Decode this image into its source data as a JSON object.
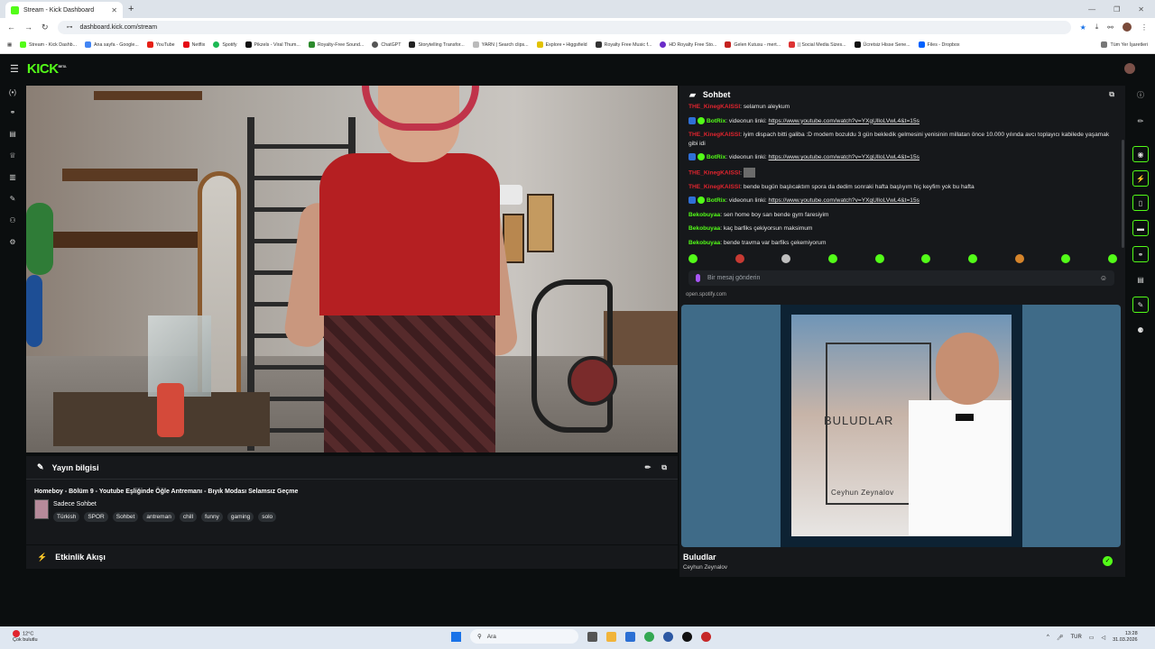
{
  "browser": {
    "tab_title": "Stream - Kick Dashboard",
    "url": "dashboard.kick.com/stream",
    "bookmarks": [
      "Stream - Kick Dashb...",
      "Ana sayfa - Google...",
      "YouTube",
      "Netflix",
      "Spotify",
      "Pikzels - Viral Thum...",
      "Royalty-Free Sound...",
      "ChatGPT",
      "Storytelling Transfor...",
      "YARN | Search clips...",
      "Explore • Higgsfield",
      "Royalty Free Music f...",
      "HD Royalty Free Sto...",
      "Gelen Kutusu - mert...",
      "|| Social Media Sizes...",
      "Ücretsiz Hisse Sene...",
      "Files - Dropbox"
    ],
    "all_bookmarks": "Tüm Yer İşaretleri"
  },
  "app": {
    "logo": "KICK",
    "logo_tag": "BETA"
  },
  "stream_info": {
    "header": "Yayın bilgisi",
    "title": "Homeboy - Bölüm 9 - Youtube Eşliğinde Öğle Antremanı - Bıyık Modası Selamsız Geçme",
    "category": "Sadece Sohbet",
    "tags": [
      "Türkish",
      "SPOR",
      "Sohbet",
      "antreman",
      "chill",
      "funny",
      "gaming",
      "solo"
    ]
  },
  "activity": {
    "header": "Etkinlik Akışı"
  },
  "chat": {
    "header": "Sohbet",
    "messages": [
      {
        "user": "THE_KinegKAISSI",
        "text": ": selamun aleykum",
        "kind": "red"
      },
      {
        "user": "BotRix",
        "text": ": videonun linki: ",
        "link": "https://www.youtube.com/watch?v=YXgUlloLVwL4&t=15s",
        "kind": "bot"
      },
      {
        "user": "THE_KinegKAISSI",
        "text": ": iyim dispach bitti galiba :D modem bozuldu 3 gün bekledik gelmesini yenisinin millatan önce 10.000 yılında avcı toplayıcı kabilede yaşamak gibi idi",
        "kind": "red"
      },
      {
        "user": "BotRix",
        "text": ": videonun linki: ",
        "link": "https://www.youtube.com/watch?v=YXgUlloLVwL4&t=15s",
        "kind": "bot"
      },
      {
        "user": "THE_KinegKAISSI",
        "text": ":",
        "kind": "red-emote"
      },
      {
        "user": "THE_KinegKAISSI",
        "text": ": bende bugün başlıcaktım spora da dedim sonraki hafta başlıyım hiç keyfim yok bu hafta",
        "kind": "red"
      },
      {
        "user": "BotRix",
        "text": ": videonun linki: ",
        "link": "https://www.youtube.com/watch?v=YXgUlloLVwL4&t=15s",
        "kind": "bot"
      },
      {
        "user": "Bekobuyaa",
        "text": ": sen home boy san bende gym faresiyim",
        "kind": "green"
      },
      {
        "user": "Bekobuyaa",
        "text": ": kaç barfiks çekiyorsun maksimum",
        "kind": "green"
      },
      {
        "user": "Bekobuyaa",
        "text": ": bende travma var barfiks çekemiyorum",
        "kind": "green"
      }
    ],
    "input_placeholder": "Bir mesaj gönderin"
  },
  "spotify": {
    "source": "open.spotify.com",
    "cover_title": "BULUDLAR",
    "cover_artist": "Ceyhun Zeynalov",
    "song_title": "Buludlar",
    "song_artist": "Ceyhun Zeynalov"
  },
  "taskbar": {
    "temp": "12°C",
    "weather": "Çok bulutlu",
    "search": "Ara",
    "lang": "TUR",
    "time": "13:28",
    "date": "31.03.2026",
    "notif_count": "2"
  }
}
